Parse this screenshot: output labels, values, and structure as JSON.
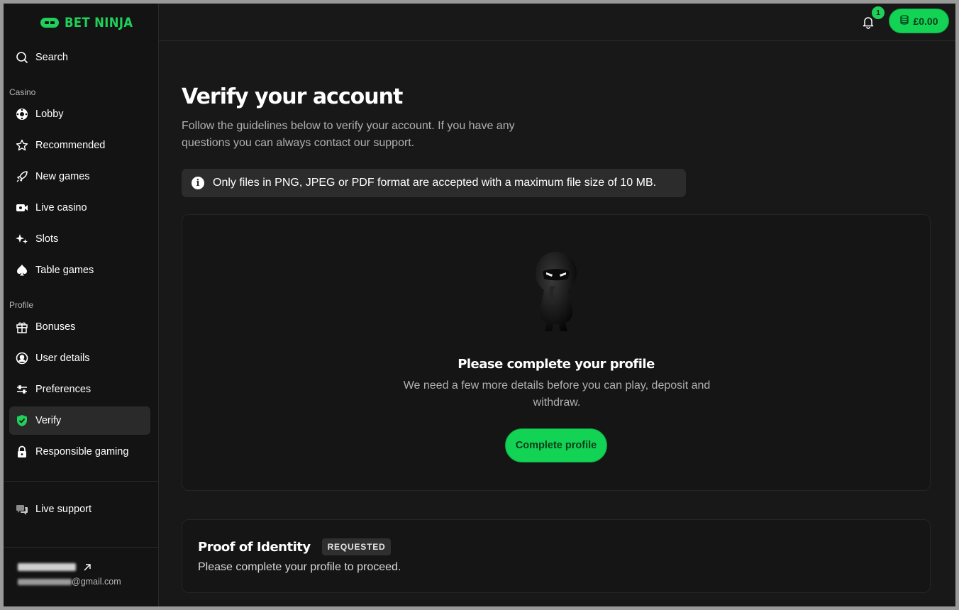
{
  "brand": {
    "logo_text": "BET NINJA",
    "accent": "#1fd15a"
  },
  "sidebar": {
    "search_label": "Search",
    "sections": {
      "casino": "Casino",
      "profile": "Profile"
    },
    "casino_items": [
      {
        "label": "Lobby",
        "icon": "lobby-icon"
      },
      {
        "label": "Recommended",
        "icon": "star-icon"
      },
      {
        "label": "New games",
        "icon": "rocket-icon"
      },
      {
        "label": "Live casino",
        "icon": "camera-icon"
      },
      {
        "label": "Slots",
        "icon": "sparkles-icon"
      },
      {
        "label": "Table games",
        "icon": "spade-icon"
      }
    ],
    "profile_items": [
      {
        "label": "Bonuses",
        "icon": "gift-icon"
      },
      {
        "label": "User details",
        "icon": "user-circle-icon"
      },
      {
        "label": "Preferences",
        "icon": "sliders-icon"
      },
      {
        "label": "Verify",
        "icon": "shield-check-icon",
        "active": true
      },
      {
        "label": "Responsible gaming",
        "icon": "lock-icon"
      }
    ],
    "support_label": "Live support",
    "user": {
      "email_suffix": "@gmail.com"
    }
  },
  "topbar": {
    "notification_count": "1",
    "balance": "£0.00"
  },
  "main": {
    "title": "Verify your account",
    "subtitle": "Follow the guidelines below to verify your account. If you have any questions you can always contact our support.",
    "notice": "Only files in PNG, JPEG or PDF format are accepted with a maximum file size of 10 MB.",
    "profile_card": {
      "title": "Please complete your profile",
      "text": "We need a few more details before you can play, deposit and withdraw.",
      "button": "Complete profile"
    },
    "identity_card": {
      "title": "Proof of Identity",
      "status": "REQUESTED",
      "text": "Please complete your profile to proceed."
    }
  }
}
